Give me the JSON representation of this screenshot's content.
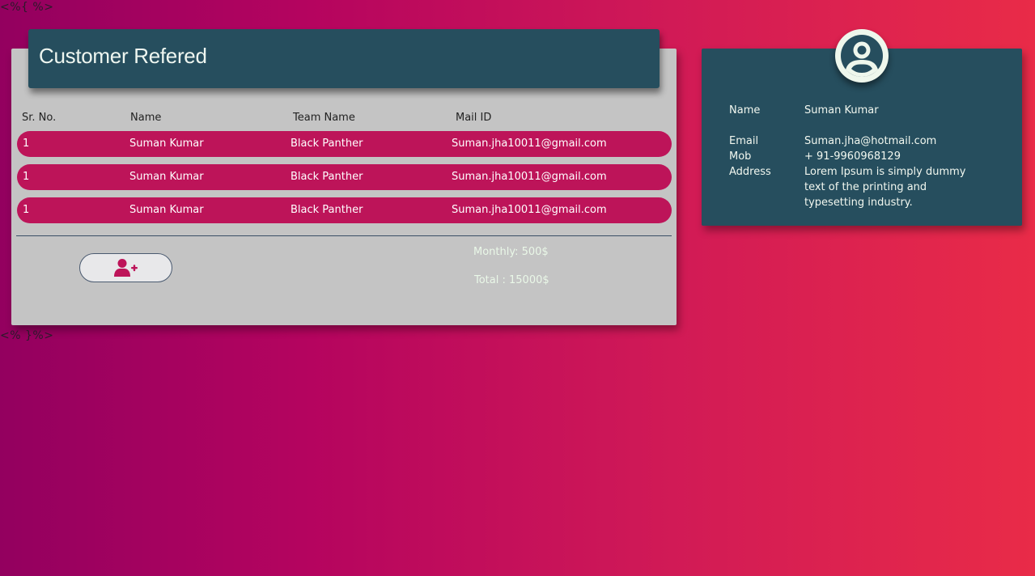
{
  "template": {
    "open_tag": "<%{ %>",
    "close_tag": "<% }%>"
  },
  "referred": {
    "title": "Customer Refered",
    "columns": [
      "Sr. No.",
      "Name",
      "Team Name",
      "Mail ID"
    ],
    "rows": [
      {
        "sr": "1",
        "name": "Suman Kumar",
        "team": "Black Panther",
        "mail": "Suman.jha10011@gmail.com"
      },
      {
        "sr": "1",
        "name": "Suman Kumar",
        "team": "Black Panther",
        "mail": "Suman.jha10011@gmail.com"
      },
      {
        "sr": "1",
        "name": "Suman Kumar",
        "team": "Black Panther",
        "mail": "Suman.jha10011@gmail.com"
      }
    ],
    "add_button_icon": "user-plus-icon",
    "monthly": "Monthly: 500$",
    "total": "Total : 15000$"
  },
  "profile": {
    "avatar_icon": "user-circle-icon",
    "name_label": "Name",
    "name_value": "Suman Kumar",
    "email_label": "Email",
    "email_value": "Suman.jha@hotmail.com",
    "mob_label": "Mob",
    "mob_value": "+ 91-9960968129",
    "address_label": "Address",
    "address_value": "Lorem Ipsum is simply dummy text of the printing and typesetting industry."
  },
  "colors": {
    "panel_dark": "#264e5e",
    "row_accent": "#bd1459",
    "card_gray": "#c4c4c4"
  }
}
